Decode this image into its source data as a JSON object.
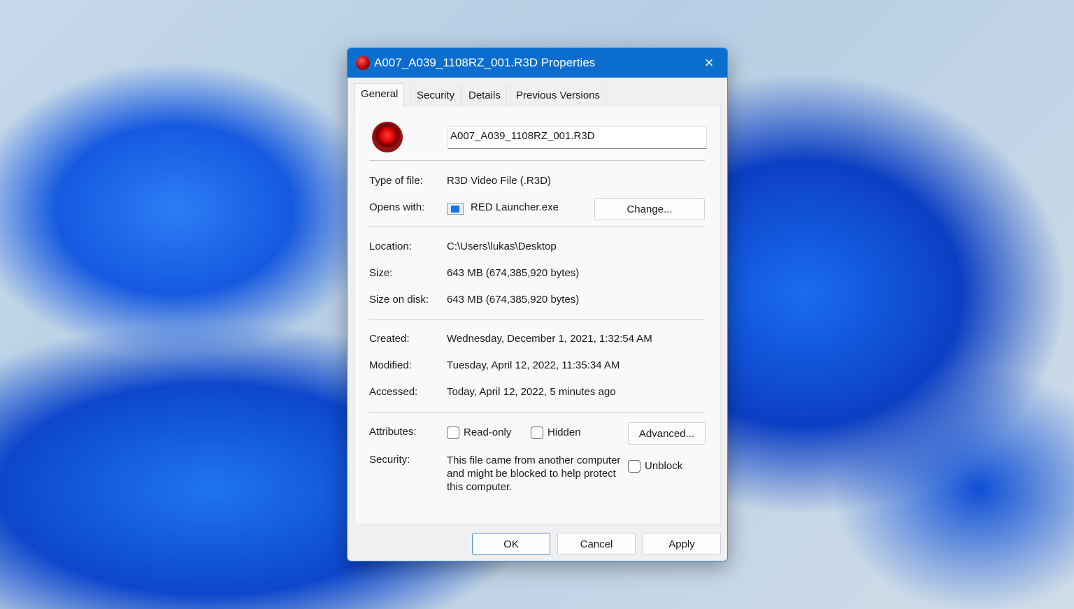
{
  "window": {
    "title": "A007_A039_1108RZ_001.R3D Properties",
    "close_icon": "×"
  },
  "tabs": [
    {
      "label": "General"
    },
    {
      "label": "Security"
    },
    {
      "label": "Details"
    },
    {
      "label": "Previous Versions"
    }
  ],
  "general": {
    "filename": "A007_A039_1108RZ_001.R3D",
    "type_label": "Type of file:",
    "type_value": "R3D Video File (.R3D)",
    "opens_label": "Opens with:",
    "opens_value": "RED Launcher.exe",
    "change_button": "Change...",
    "location_label": "Location:",
    "location_value": "C:\\Users\\lukas\\Desktop",
    "size_label": "Size:",
    "size_value": "643 MB (674,385,920 bytes)",
    "size_disk_label": "Size on disk:",
    "size_disk_value": "643 MB (674,385,920 bytes)",
    "created_label": "Created:",
    "created_value": "Wednesday, December 1, 2021, 1:32:54 AM",
    "modified_label": "Modified:",
    "modified_value": "Tuesday, April 12, 2022, 11:35:34 AM",
    "accessed_label": "Accessed:",
    "accessed_value": "Today, April 12, 2022, 5 minutes ago",
    "attributes_label": "Attributes:",
    "readonly_label": "Read-only",
    "hidden_label": "Hidden",
    "advanced_button": "Advanced...",
    "security_label": "Security:",
    "security_text": "This file came from another computer and might be blocked to help protect this computer.",
    "unblock_label": "Unblock"
  },
  "footer": {
    "ok": "OK",
    "cancel": "Cancel",
    "apply": "Apply"
  },
  "colors": {
    "titlebar": "#0b6ecf"
  }
}
